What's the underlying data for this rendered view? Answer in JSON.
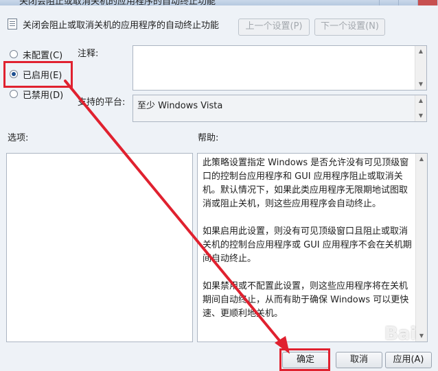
{
  "window": {
    "titlebar_text": "关闭会阻止或取消关机的应用程序的自动终止功能"
  },
  "header": {
    "policy_title": "关闭会阻止或取消关机的应用程序的自动终止功能",
    "prev_label": "上一个设置(P)",
    "next_label": "下一个设置(N)"
  },
  "options": {
    "not_configured": "未配置(C)",
    "enabled": "已启用(E)",
    "disabled": "已禁用(D)",
    "selected": "enabled"
  },
  "comment": {
    "label": "注释:",
    "value": ""
  },
  "platform": {
    "label": "支持的平台:",
    "value": "至少 Windows Vista"
  },
  "sections": {
    "options_label": "选项:",
    "help_label": "帮助:"
  },
  "help": {
    "paragraphs": [
      "此策略设置指定 Windows 是否允许没有可见顶级窗口的控制台应用程序和 GUI 应用程序阻止或取消关机。默认情况下，如果此类应用程序无限期地试图取消或阻止关机，则这些应用程序会自动终止。",
      "如果启用此设置，则没有可见顶级窗口且阻止或取消关机的控制台应用程序或 GUI 应用程序不会在关机期间自动终止。",
      "如果禁用或不配置此设置，则这些应用程序将在关机期间自动终止，从而有助于确保 Windows 可以更快速、更顺利地关机。"
    ]
  },
  "footer": {
    "ok_label": "确定",
    "cancel_label": "取消",
    "apply_label": "应用(A)"
  },
  "watermark": "Bai",
  "colors": {
    "annotation_red": "#e0212f",
    "dialog_bg": "#eef2f7"
  }
}
